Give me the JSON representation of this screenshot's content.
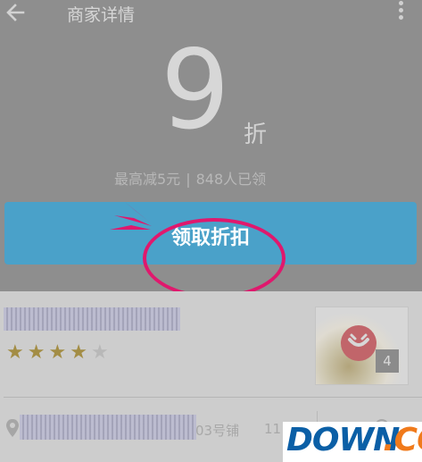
{
  "header": {
    "back_icon": "arrow-left-icon",
    "title": "商家详情",
    "more_icon": "more-vertical-icon"
  },
  "discount": {
    "value": "9",
    "unit": "折",
    "max_reduction": "最高减5元",
    "separator": "|",
    "claimed": "848人已领"
  },
  "claim_button": {
    "label": "领取折扣",
    "highlight_color": "#e0186d",
    "button_color": "#4aa1c9"
  },
  "store": {
    "rating_stars": 4,
    "rating_max": 5,
    "photo_count": "4",
    "address_suffix": "03号铺",
    "distance_fragment": "11"
  },
  "watermark": {
    "brand": "DOWN",
    "suffix": ".CC"
  }
}
